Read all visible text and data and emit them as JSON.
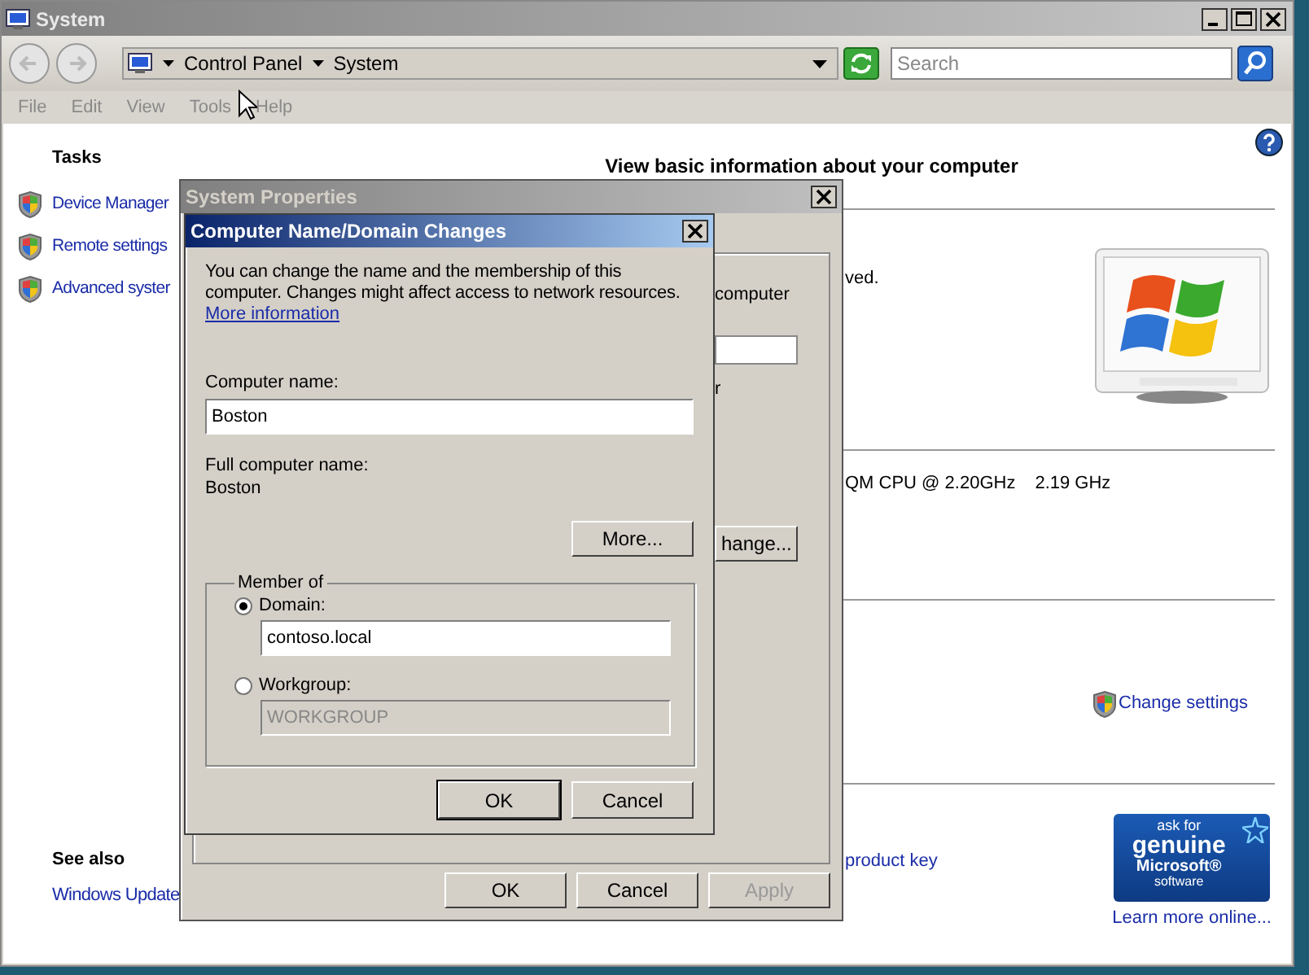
{
  "window": {
    "title": "System"
  },
  "address_bar": {
    "crumbs": [
      "Control Panel",
      "System"
    ]
  },
  "search": {
    "placeholder": "Search"
  },
  "menu": [
    "File",
    "Edit",
    "View",
    "Tools",
    "Help"
  ],
  "sidebar": {
    "title": "Tasks",
    "links": [
      "Device Manager",
      "Remote settings",
      "Advanced syster"
    ],
    "see_also_title": "See also",
    "see_also_links": [
      "Windows Update"
    ]
  },
  "main": {
    "heading": "View basic information about your computer",
    "edition_fragment": "ved.",
    "processor_fragment": "QM CPU @ 2.20GHz",
    "processor_speed": "2.19 GHz",
    "change_settings": "Change settings",
    "product_key_fragment": "product key",
    "genuine_badge": [
      "ask for",
      "genuine",
      "Microsoft®",
      "software"
    ],
    "learn_more": "Learn more online..."
  },
  "system_properties": {
    "title": "System Properties",
    "fragments": [
      "computer",
      "r"
    ],
    "change_button": "hange...",
    "buttons": [
      {
        "label": "OK",
        "disabled": false
      },
      {
        "label": "Cancel",
        "disabled": false
      },
      {
        "label": "Apply",
        "disabled": true
      }
    ]
  },
  "dialog": {
    "title": "Computer Name/Domain Changes",
    "description": "You can change the name and the membership of this computer. Changes might affect access to network resources.",
    "link": "More information",
    "computer_name_label": "Computer name:",
    "computer_name": "Boston",
    "full_name_label": "Full computer name:",
    "full_name": "Boston",
    "more_button": "More...",
    "member_of": {
      "legend": "Member of",
      "options": [
        {
          "label": "Domain:",
          "selected": true,
          "value": "contoso.local"
        },
        {
          "label": "Workgroup:",
          "selected": false,
          "value": "WORKGROUP"
        }
      ]
    },
    "buttons": [
      "OK",
      "Cancel"
    ]
  }
}
